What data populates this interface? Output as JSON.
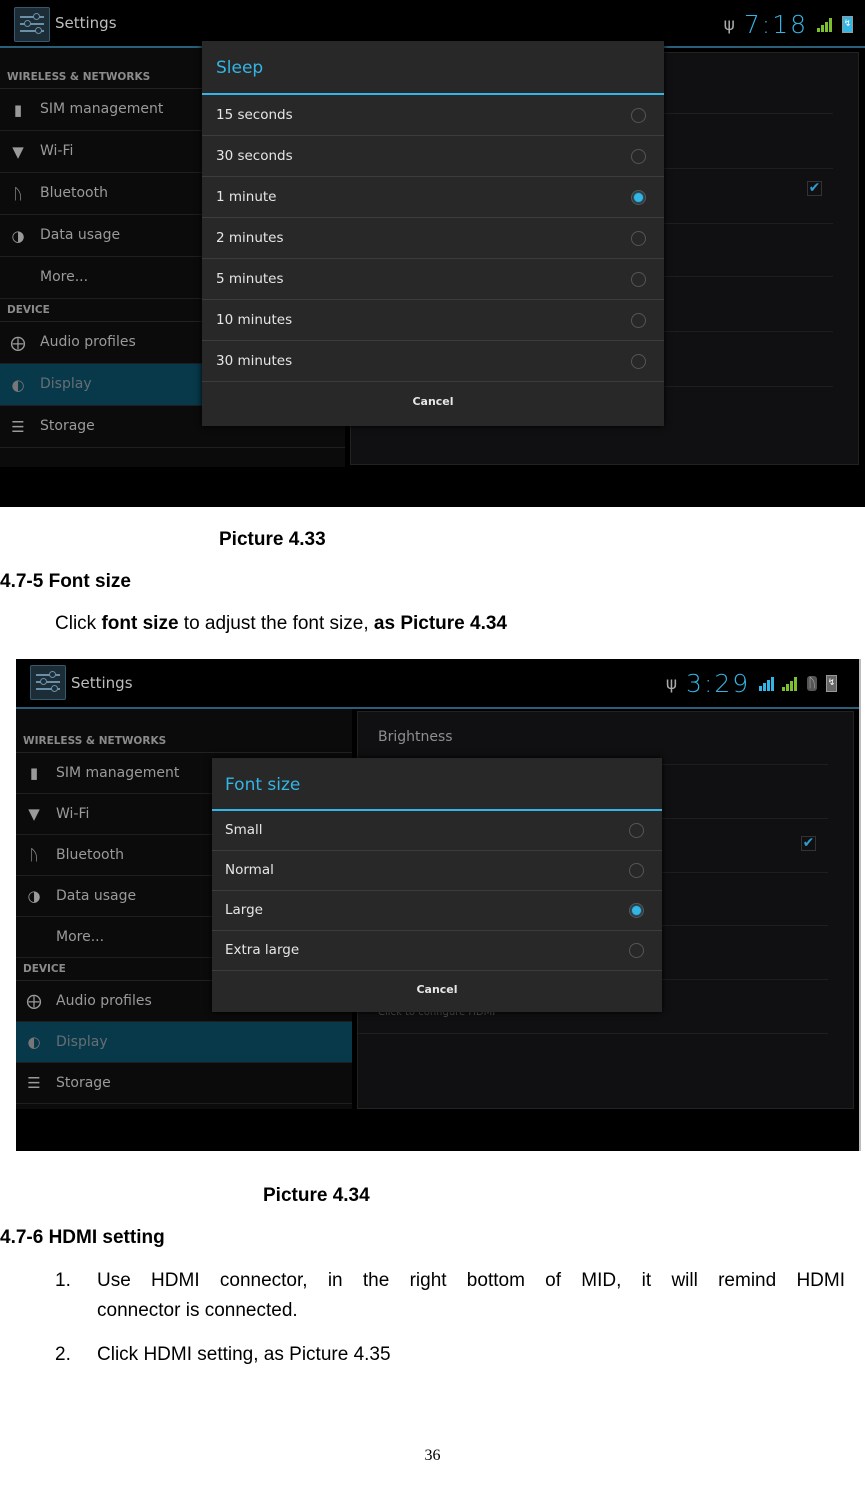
{
  "screenshot1": {
    "app_title": "Settings",
    "status": {
      "usb_icon": "usb-icon",
      "time": "7:18",
      "signal_icon": "signal-icon",
      "battery_icon": "battery-charging-icon"
    },
    "sidebar": {
      "section_wireless": "WIRELESS & NETWORKS",
      "items_wireless": [
        {
          "label": "SIM management",
          "icon": "sim-icon"
        },
        {
          "label": "Wi-Fi",
          "icon": "wifi-icon"
        },
        {
          "label": "Bluetooth",
          "icon": "bluetooth-icon"
        },
        {
          "label": "Data usage",
          "icon": "data-usage-icon"
        },
        {
          "label": "More...",
          "icon": ""
        }
      ],
      "section_device": "DEVICE",
      "items_device": [
        {
          "label": "Audio profiles",
          "icon": "audio-profiles-icon"
        },
        {
          "label": "Display",
          "icon": "display-icon",
          "active": true
        },
        {
          "label": "Storage",
          "icon": "storage-icon"
        }
      ]
    },
    "dialog": {
      "title": "Sleep",
      "options": [
        "15 seconds",
        "30 seconds",
        "1 minute",
        "2 minutes",
        "5 minutes",
        "10 minutes",
        "30 minutes"
      ],
      "selected": "1 minute",
      "cancel": "Cancel"
    }
  },
  "caption1": "Picture 4.33",
  "section1": {
    "heading": "4.7-5 Font size",
    "text_pre": "Click ",
    "text_bold1": "font size",
    "text_mid": " to adjust the font size, ",
    "text_bold2": "as Picture 4.34"
  },
  "screenshot2": {
    "app_title": "Settings",
    "status": {
      "usb_icon": "usb-icon",
      "time": "3:29",
      "data_icon": "mobile-data-e-icon",
      "signal_icon": "signal-icon",
      "bluetooth_icon": "bluetooth-icon",
      "battery_icon": "battery-charging-icon"
    },
    "sidebar": {
      "section_wireless": "WIRELESS & NETWORKS",
      "items_wireless": [
        {
          "label": "SIM management"
        },
        {
          "label": "Wi-Fi"
        },
        {
          "label": "Bluetooth"
        },
        {
          "label": "Data usage"
        },
        {
          "label": "More..."
        }
      ],
      "section_device": "DEVICE",
      "items_device": [
        {
          "label": "Audio profiles"
        },
        {
          "label": "Display",
          "active": true
        },
        {
          "label": "Storage"
        }
      ]
    },
    "right_pane": {
      "brightness": "Brightness",
      "hdmi_hint": "Click to configure HDMI"
    },
    "dialog": {
      "title": "Font size",
      "options": [
        "Small",
        "Normal",
        "Large",
        "Extra large"
      ],
      "selected": "Large",
      "cancel": "Cancel"
    }
  },
  "caption2": "Picture 4.34",
  "section2": {
    "heading": "4.7-6 HDMI setting",
    "items": [
      {
        "num": "1.",
        "text": "Use HDMI connector, in the right bottom of MID, it will remind HDMI",
        "text2": "connector is connected."
      },
      {
        "num": "2.",
        "text": "Click HDMI setting, as Picture 4.35"
      }
    ]
  },
  "page_number": "36"
}
